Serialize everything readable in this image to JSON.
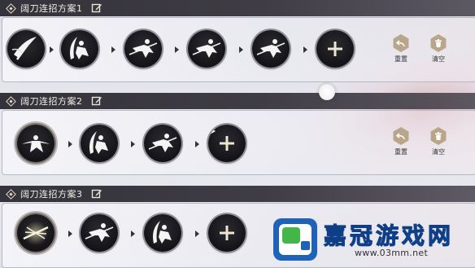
{
  "sections": [
    {
      "title": "阔刀连招方案1",
      "slots": [
        "sword-swing-skill-icon",
        "leaping-strike-skill-icon",
        "dash-slash-skill-icon",
        "dash-slash-skill-icon",
        "dash-slash-skill-icon",
        "add-skill-icon"
      ],
      "actions": {
        "reset_label": "重置",
        "clear_label": "清空"
      }
    },
    {
      "title": "阔刀连招方案2",
      "slots": [
        "spin-slash-skill-icon",
        "leaping-strike-skill-icon",
        "dash-slash-skill-icon",
        "add-skill-icon"
      ],
      "actions": {
        "reset_label": "重置",
        "clear_label": "清空"
      }
    },
    {
      "title": "阔刀连招方案3",
      "slots": [
        "radiant-blade-skill-icon",
        "dash-slash-skill-icon",
        "leaping-strike-skill-icon",
        "add-skill-icon"
      ]
    }
  ],
  "watermark": {
    "brand": "嘉冠游戏网",
    "url": "www.03mm.net"
  },
  "colors": {
    "header": "#34323a",
    "panel_border": "#b7b8c4",
    "action_hex": "#b9a68a",
    "slot_ring": "#8f8f98",
    "watermark_blue": "#1e63b8"
  }
}
